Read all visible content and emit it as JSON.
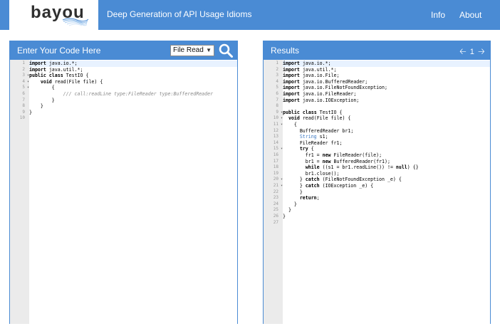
{
  "header": {
    "logo": "bayou",
    "title": "Deep Generation of API Usage Idioms",
    "nav": [
      "Info",
      "About"
    ],
    "bar_color": "#4a8bd4"
  },
  "left_panel": {
    "title": "Enter Your Code Here",
    "select_value": "File Read",
    "search_icon": "search-icon",
    "lines": [
      "import java.io.*;",
      "import java.util.*;",
      "public class TestIO {",
      "    void read(File file) {",
      "        {",
      "            /// call:readLine type:FileReader type:BufferedReader",
      "        }",
      "    }",
      "}",
      ""
    ]
  },
  "right_panel": {
    "title": "Results",
    "page": "1",
    "lines": [
      "import java.io.*;",
      "import java.util.*;",
      "import java.io.File;",
      "import java.io.BufferedReader;",
      "import java.io.FileNotFoundException;",
      "import java.io.FileReader;",
      "import java.io.IOException;",
      "",
      "public class TestIO {",
      "  void read(File file) {",
      "    {",
      "      BufferedReader br1;",
      "      String s1;",
      "      FileReader fr1;",
      "      try {",
      "        fr1 = new FileReader(file);",
      "        br1 = new BufferedReader(fr1);",
      "        while ((s1 = br1.readLine()) != null) {}",
      "        br1.close();",
      "      } catch (FileNotFoundException _e) {",
      "      } catch (IOException _e) {",
      "      }",
      "      return;",
      "    }",
      "  }",
      "}",
      ""
    ]
  }
}
